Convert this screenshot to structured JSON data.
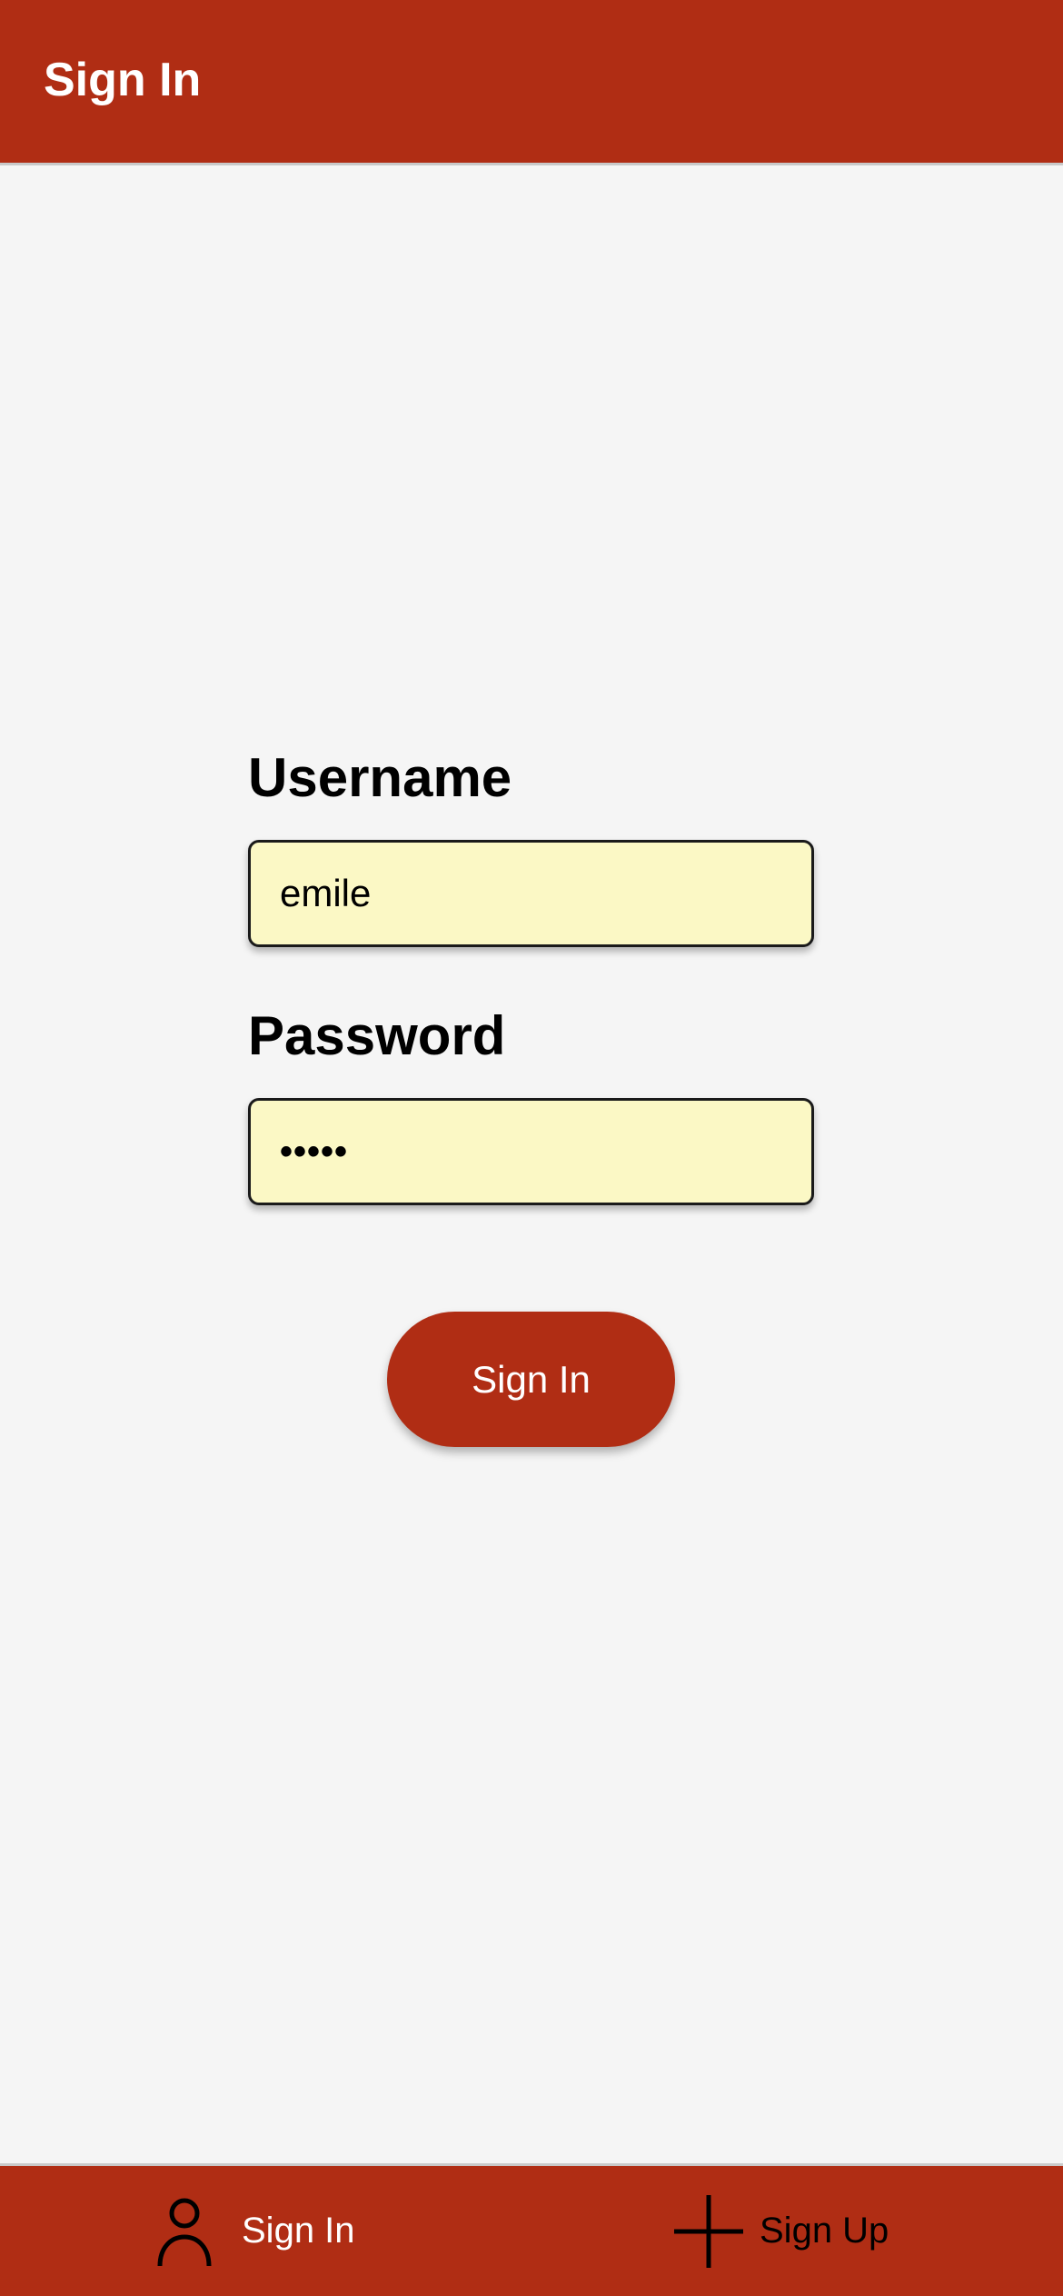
{
  "header": {
    "title": "Sign In"
  },
  "form": {
    "username_label": "Username",
    "username_value": "emile",
    "password_label": "Password",
    "password_mask": "•••••",
    "submit_label": "Sign In"
  },
  "bottom_nav": {
    "items": [
      {
        "label": "Sign In",
        "icon": "person-icon",
        "active": true
      },
      {
        "label": "Sign Up",
        "icon": "plus-icon",
        "active": false
      }
    ]
  },
  "colors": {
    "brand": "#b02d14",
    "background": "#f5f5f5",
    "input_background": "#fbf8c5",
    "active_nav_text": "#ffffff",
    "inactive_nav_text": "#000000"
  }
}
